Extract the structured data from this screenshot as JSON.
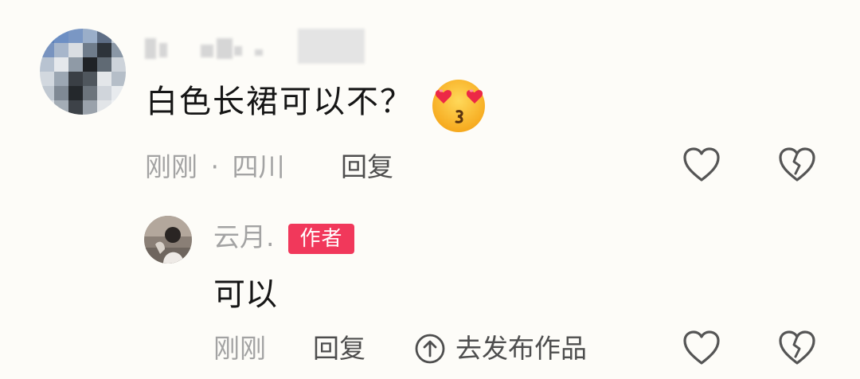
{
  "comment": {
    "text": "白色长裙可以不？",
    "emoji": "smiling-face-with-heart-eyes-kiss",
    "time": "刚刚",
    "separator": "·",
    "location": "四川",
    "reply_label": "回复"
  },
  "reply": {
    "username": "云月.",
    "badge": "作者",
    "text": "可以",
    "time": "刚刚",
    "reply_label": "回复",
    "publish_label": "去发布作品"
  },
  "icons": {
    "like": "heart-outline-icon",
    "dislike": "broken-heart-outline-icon",
    "publish": "arrow-up-circle-icon"
  },
  "colors": {
    "background": "#fdfcf8",
    "badge": "#f1385b",
    "text_primary": "#161616",
    "text_muted": "#a3a3a3",
    "text_action": "#4e4e4e"
  }
}
